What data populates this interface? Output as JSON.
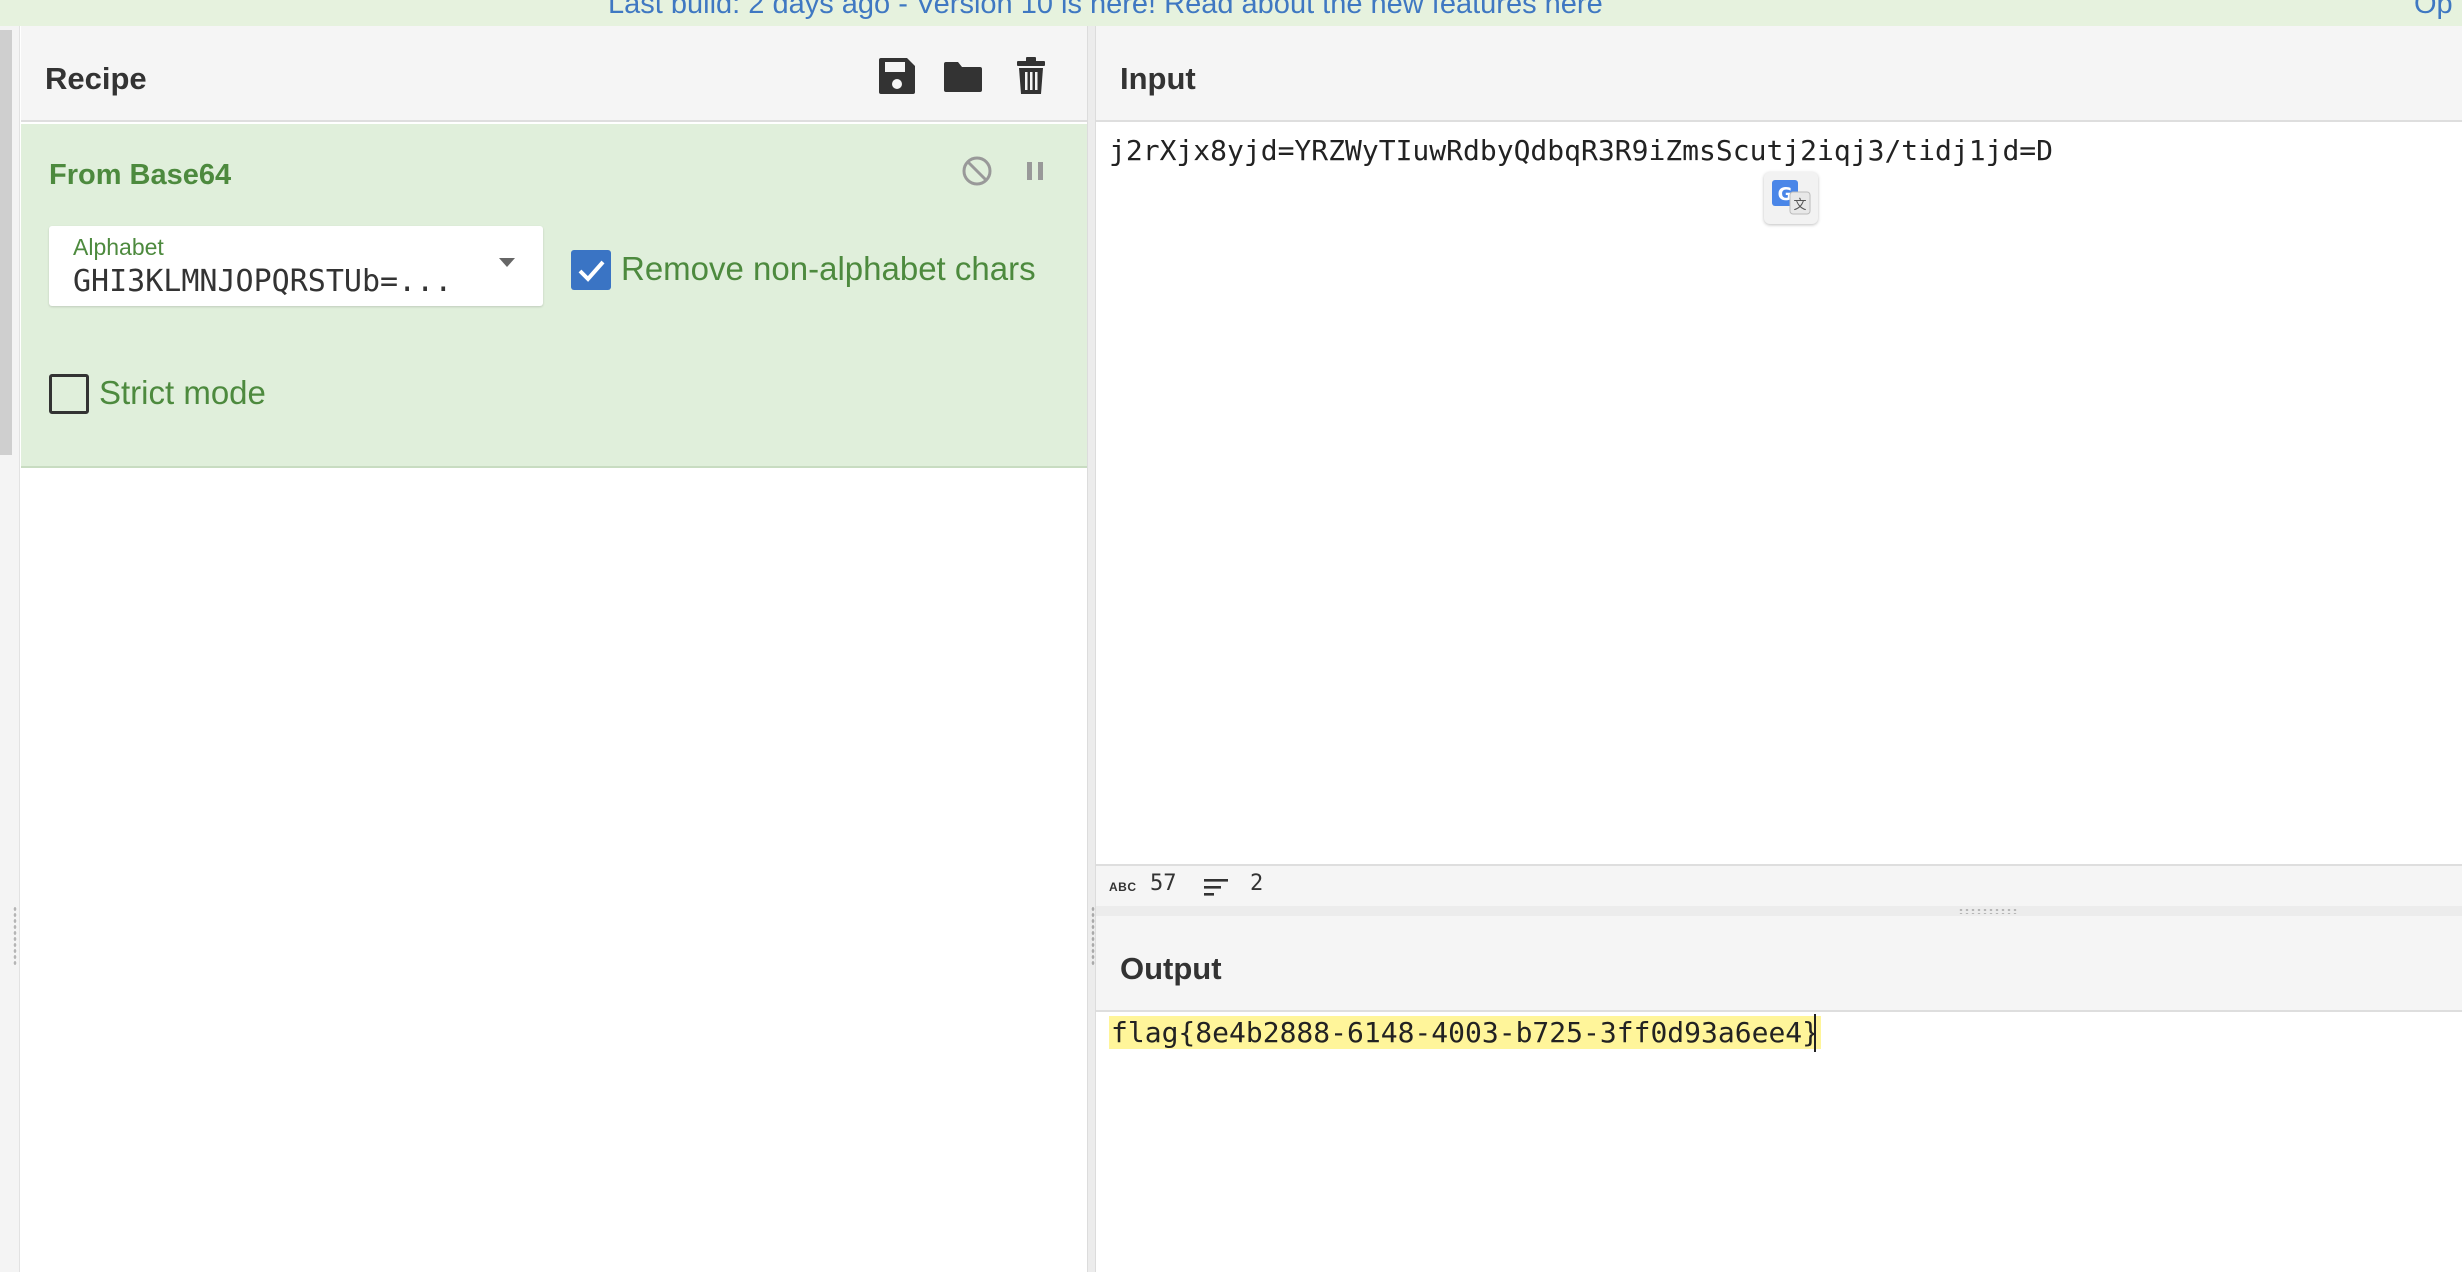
{
  "banner": {
    "text": "Last build: 2 days ago - Version 10 is here! Read about the new features here",
    "right_text": "Op"
  },
  "recipe": {
    "title": "Recipe",
    "icons": [
      "save-icon",
      "folder-icon",
      "trash-icon"
    ],
    "operation": {
      "title": "From Base64",
      "icons": [
        "disable-icon",
        "pause-icon"
      ],
      "alphabet_label": "Alphabet",
      "alphabet_value": "GHI3KLMNJOPQRSTUb=...",
      "remove_non_alphabet": {
        "label": "Remove non-alphabet chars",
        "checked": true
      },
      "strict_mode": {
        "label": "Strict mode",
        "checked": false
      }
    }
  },
  "input": {
    "title": "Input",
    "text": "j2rXjx8yjd=YRZWyTIuwRdbyQdbqR3R9iZmsScutj2iqj3/tidj1jd=D",
    "stats": {
      "chars_icon": "ABC",
      "chars": "57",
      "lines": "2"
    }
  },
  "output": {
    "title": "Output",
    "text": "flag{8e4b2888-6148-4003-b725-3ff0d93a6ee4}"
  },
  "colors": {
    "accent_green": "#4d8a3e",
    "op_background": "#e0efdb",
    "checkbox_blue": "#3a74c4",
    "highlight": "#fff59a",
    "banner_bg": "#e6f2de",
    "banner_link": "#3f78c2"
  }
}
